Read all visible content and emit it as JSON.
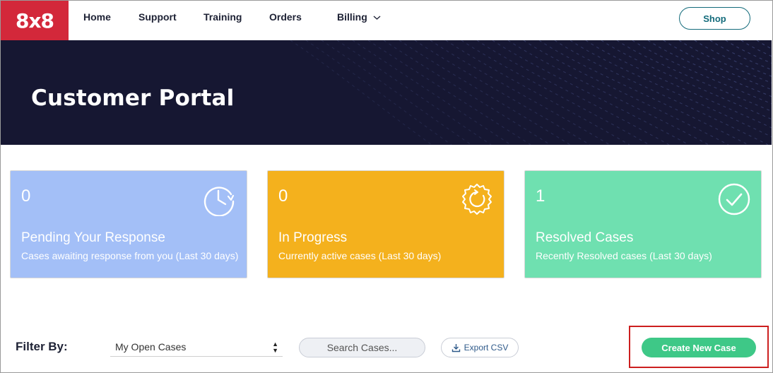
{
  "nav": {
    "logo": "8x8",
    "items": [
      {
        "label": "Home"
      },
      {
        "label": "Support"
      },
      {
        "label": "Training"
      },
      {
        "label": "Orders"
      },
      {
        "label": "Billing"
      }
    ],
    "shop_label": "Shop"
  },
  "hero": {
    "title": "Customer Portal"
  },
  "cards": {
    "pending": {
      "count": "0",
      "title": "Pending Your Response",
      "description": "Cases awaiting response from you (Last 30 days)",
      "icon": "clock-icon",
      "color": "#a3bff7"
    },
    "progress": {
      "count": "0",
      "title": "In Progress",
      "description": "Currently active cases (Last 30 days)",
      "icon": "gear-progress-icon",
      "color": "#f4b11d"
    },
    "resolved": {
      "count": "1",
      "title": "Resolved Cases",
      "description": "Recently Resolved cases (Last 30 days)",
      "icon": "check-circle-icon",
      "color": "#6fe0b0"
    }
  },
  "filter": {
    "label": "Filter By:",
    "selected": "My Open Cases",
    "search_placeholder": "Search Cases...",
    "export_label": "Export CSV",
    "create_label": "Create New Case"
  },
  "colors": {
    "brand_red": "#d3283a",
    "hero_bg": "#161732",
    "create_green": "#3ec887",
    "shop_teal": "#136b7b"
  }
}
